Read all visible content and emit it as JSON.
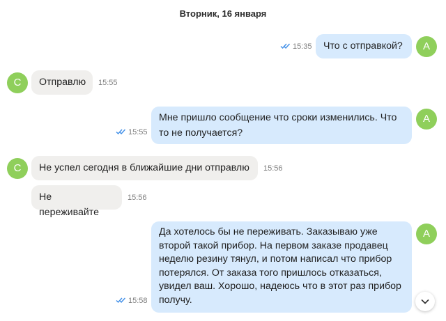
{
  "chat": {
    "date_label": "Вторник, 16 января",
    "outgoing_avatar_letter": "A",
    "incoming_avatar_letter": "C",
    "messages": [
      {
        "direction": "out",
        "text": "Что с отправкой?",
        "time": "15:35",
        "read": true
      },
      {
        "direction": "in",
        "text": "Отправлю",
        "time": "15:55"
      },
      {
        "direction": "out",
        "lines": [
          "Мне пришло сообщение что сроки изменились. Что",
          "то не получается?"
        ],
        "time": "15:55",
        "read": true
      },
      {
        "direction": "in",
        "text": "Не успел сегодня в ближайшие дни отправлю",
        "time": "15:56"
      },
      {
        "direction": "in",
        "text": "Не переживайте",
        "time": "15:56"
      },
      {
        "direction": "out",
        "lines": [
          "Да хотелось бы не переживать. Заказываю уже",
          "второй такой прибор. На первом заказе продавец",
          "неделю резину тянул, и потом написал что прибор",
          "потерялся. От заказа того пришлось отказаться,",
          "увидел ваш. Хорошо, надеюсь что в этот раз прибор",
          "получу."
        ],
        "time": "15:58",
        "read": true
      }
    ]
  },
  "colors": {
    "incoming_bubble": "#f0efed",
    "outgoing_bubble": "#d7eafd",
    "avatar": "#8fcf5b",
    "read_ticks": "#3f8ee8"
  },
  "icons": {
    "read_ticks": "double-check-icon",
    "scroll_down": "chevron-down-icon"
  }
}
